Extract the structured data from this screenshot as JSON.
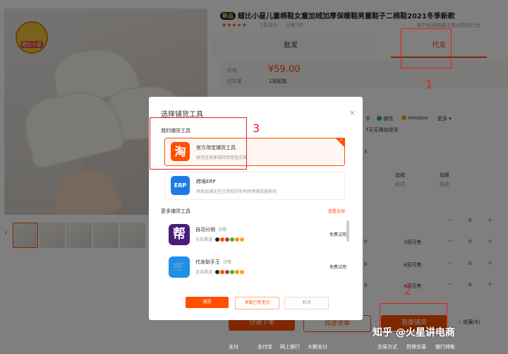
{
  "product": {
    "new_badge": "新品",
    "title": "蜡比小星儿童棉鞋女童加绒加厚保暖鞋男童鞋子二棉鞋2021冬季新款",
    "stars": "★★★★★",
    "reviews": "1条评价",
    "sold": "已售7件",
    "right_meta": "本产品采购属于商业性购行为",
    "logo_text": "蜡比小星"
  },
  "tabs": {
    "wholesale": "批发",
    "dropship": "代发"
  },
  "price_row": {
    "price_label": "价格",
    "price": "¥59.00",
    "moq_label": "起批量",
    "moq": "1双起批"
  },
  "bg_right": {
    "platforms": [
      "手",
      "微信",
      "Amazon",
      "更多"
    ],
    "return": "7天无理由退货",
    "num5": "5",
    "thick_headers": [
      "加绒",
      "加厚"
    ],
    "thick_values": [
      "款式",
      "厚度"
    ],
    "stock_rows": [
      "3双可售",
      "4双可售",
      "4双可售"
    ],
    "qty": [
      "0",
      "0",
      "0",
      "0"
    ]
  },
  "bottom_buttons": {
    "order": "分销下单",
    "add_cart": "加进货单",
    "my_stock": "我要铺货"
  },
  "favorite": "收藏(6)",
  "bottom_row": {
    "pay_label": "支付",
    "pay1": "支付宝",
    "pay2": "网上银行",
    "pay3": "大额支付",
    "txn_label": "交易方式",
    "txn1": "担保交易",
    "txn2": "银行转账"
  },
  "modal": {
    "title": "选择铺货工具",
    "close": "×",
    "my_tools_label": "我的铺货工具",
    "my_tools": [
      {
        "name": "官方淘宝铺货工具",
        "desc": "供淘宝卖家铺货到淘宝店铺",
        "icon": "淘",
        "color": "#ff5000"
      },
      {
        "name": "跨境ERP",
        "desc": "将商品铺送至已授权的所有跨境铺货服务商",
        "icon": "ERP",
        "color": "#1e7be6"
      }
    ],
    "more_label": "更多铺货工具",
    "view_all": "查看全部",
    "more_tools": [
      {
        "name": "自动分销",
        "detail": "详情",
        "support": "支持渠道",
        "trial": "免费试用",
        "icon": "帮",
        "color": "#4a1d7a"
      },
      {
        "name": "代发助手王",
        "detail": "详情",
        "support": "支持渠道",
        "trial": "免费试用",
        "icon": "🛒",
        "color": "#1c8fe8"
      }
    ],
    "buttons": {
      "primary": "铺货",
      "link": "关联已有宝贝",
      "cancel": "取消"
    }
  },
  "annotations": {
    "n1": "1",
    "n2": "2",
    "n3": "3"
  },
  "watermark": "知乎 @火星讲电商",
  "bg_labels": {
    "side_left_num": "0"
  }
}
